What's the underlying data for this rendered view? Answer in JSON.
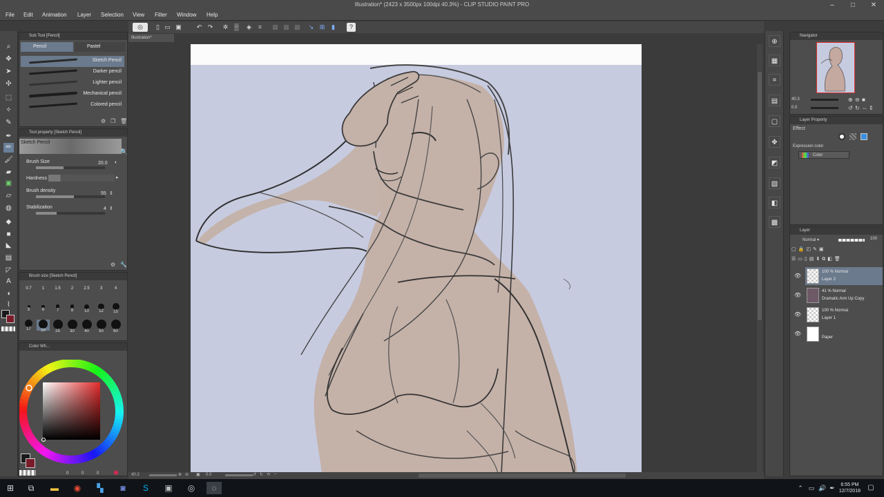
{
  "window": {
    "title": "Illustration* (2423 x 3500px 100dpi 40.3%) - CLIP STUDIO PAINT PRO"
  },
  "menu": [
    "File",
    "Edit",
    "Animation",
    "Layer",
    "Selection",
    "View",
    "Filter",
    "Window",
    "Help"
  ],
  "subtool": {
    "title": "Sub Tool [Pencil]",
    "tabs": [
      "Pencil",
      "Pastel"
    ],
    "brushes": [
      "Sketch Pencil",
      "Darker pencil",
      "Lighter pencil",
      "Mechanical pencil",
      "Colored pencil"
    ],
    "active_brush": "Sketch Pencil"
  },
  "toolprop": {
    "title": "Tool property [Sketch Pencil]",
    "preset_name": "Sketch Pencil",
    "brush_size_label": "Brush Size",
    "brush_size_value": "20.0",
    "brush_size_level": 0.4,
    "hardness_label": "Hardness",
    "brush_density_label": "Brush density",
    "brush_density_value": "55",
    "brush_density_level": 0.55,
    "stabilization_label": "Stabilization",
    "stabilization_value": "4",
    "stabilization_level": 0.3
  },
  "brushsize": {
    "title": "Brush size [Sketch Pencil]",
    "sizes": [
      "0.7",
      "1",
      "1.5",
      "2",
      "2.5",
      "3",
      "4",
      "5",
      "6",
      "7",
      "8",
      "10",
      "12",
      "15",
      "17",
      "20",
      "25",
      "30",
      "40",
      "50",
      "60"
    ]
  },
  "colorwheel": {
    "title": "Color Wh...",
    "main_color": "#7a1b2a",
    "sub_color": "#1a1a1a",
    "values": [
      "0",
      "0",
      "0"
    ]
  },
  "canvas": {
    "tab_label": "Illustration*",
    "zoom": "40.3",
    "rotation": "0.0",
    "paper_color": "#c7cbe0"
  },
  "navigator": {
    "title": "Navigator",
    "zoom": "40.3",
    "angle": "0.0"
  },
  "layerprop": {
    "title": "Layer Property",
    "effect_label": "Effect",
    "expression_color_label": "Expression color",
    "expression_color_value": "Color"
  },
  "layers": {
    "title": "Layer",
    "blend_mode": "Normal",
    "opacity": "100",
    "items": [
      {
        "line1": "100 % Normal",
        "line2": "Layer 2",
        "active": true
      },
      {
        "line1": "41 % Normal",
        "line2": "Dramatic Arm Up Copy",
        "active": false
      },
      {
        "line1": "100 % Normal",
        "line2": "Layer 1",
        "active": false
      },
      {
        "line1": "",
        "line2": "Paper",
        "active": false
      }
    ]
  },
  "taskbar": {
    "time": "6:55 PM",
    "date": "12/7/2018"
  }
}
